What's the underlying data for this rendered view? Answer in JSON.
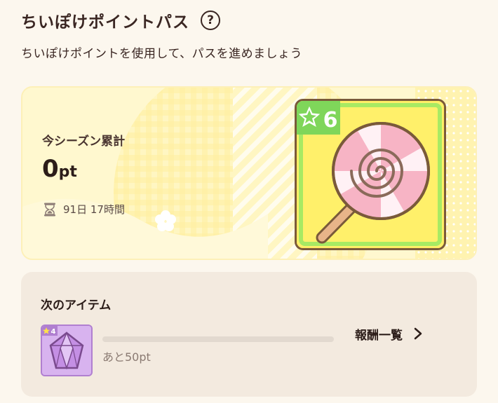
{
  "header": {
    "title": "ちいぽけポイントパス",
    "help_icon_label": "?",
    "subtitle": "ちいぽけポイントを使用して、パスを進めましょう"
  },
  "season": {
    "label": "今シーズン累計",
    "points_value": "0",
    "points_unit": "pt",
    "time_remaining": "91日 17時間",
    "reward": {
      "level_badge": "6",
      "item_icon": "lollipop-icon"
    }
  },
  "next": {
    "title": "次のアイテム",
    "item": {
      "level_badge": "4",
      "item_icon": "crystal-icon"
    },
    "progress_fraction": 0,
    "remaining_text": "あと50pt",
    "rewards_link_label": "報酬一覧"
  },
  "colors": {
    "background": "#fcf7ee",
    "season_card": "#fff7c9",
    "reward_tile": "#fff06a",
    "next_card": "#f3eadf",
    "badge_green": "#7fd65a",
    "text_dark": "#2c1d19"
  }
}
